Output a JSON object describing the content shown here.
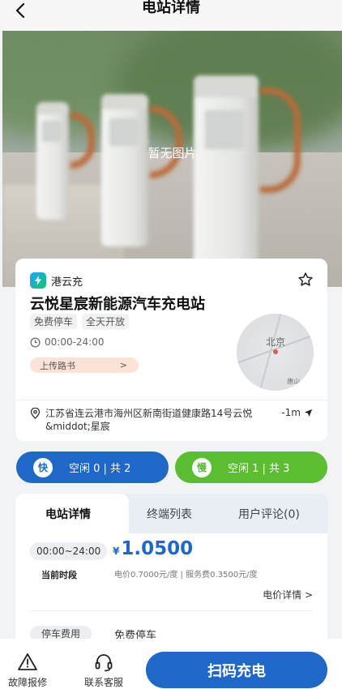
{
  "header": {
    "title": "电站详情",
    "back_icon": "chevron-left-icon"
  },
  "hero": {
    "placeholder_text": "暂无图片"
  },
  "station": {
    "brand": "港云充",
    "name": "云悦星宸新能源汽车充电站",
    "tags": [
      "免费停车",
      "全天开放"
    ],
    "hours": "00:00-24:00",
    "upload_route_label": "上传路书",
    "upload_route_arrow": ">",
    "map_label": "北京",
    "map_small_label": "唐山",
    "address": "江苏省连云港市海州区新南街道健康路14号云悦&middot;星宸",
    "distance": "-1m"
  },
  "availability": {
    "fast": {
      "badge": "快",
      "text": "空闲 0 | 共 2"
    },
    "slow": {
      "badge": "慢",
      "text": "空闲 1 | 共 3"
    }
  },
  "tabs": [
    {
      "label": "电站详情",
      "active": true
    },
    {
      "label": "终端列表",
      "active": false
    },
    {
      "label": "用户评论(0)",
      "active": false
    }
  ],
  "pricing": {
    "time_range": "00:00~24:00",
    "currency": "¥",
    "price": "1.0500",
    "period_label": "当前时段",
    "breakdown": "电价0.7000元/度 | 服务费0.3500元/度",
    "details_link": "电价详情 >"
  },
  "parking": {
    "label": "停车费用",
    "value": "免费停车"
  },
  "bottom_bar": {
    "report_label": "故障报修",
    "service_label": "联系客服",
    "scan_label": "扫码充电"
  },
  "colors": {
    "primary": "#1f68c8",
    "slow_green": "#5bbd32",
    "upload_bg": "#fde2d8"
  }
}
